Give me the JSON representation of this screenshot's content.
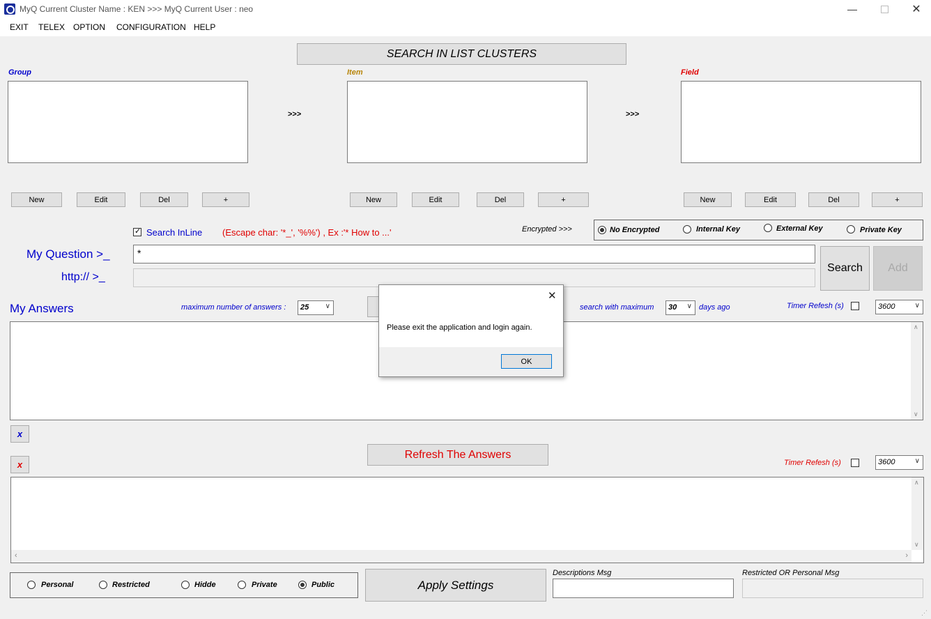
{
  "window": {
    "title": "MyQ Current Cluster Name : KEN >>> MyQ Current User : neo",
    "minimize_icon": "minimize-icon",
    "maximize_icon": "maximize-icon",
    "close_icon": "close-icon"
  },
  "menu": [
    "EXIT",
    "TELEX",
    "OPTION",
    "CONFIGURATION",
    "HELP"
  ],
  "search_clusters_label": "SEARCH IN LIST CLUSTERS",
  "columns": {
    "group": {
      "label": "Group",
      "color": "#0000cc"
    },
    "item": {
      "label": "Item",
      "color": "#b8860b"
    },
    "field": {
      "label": "Field",
      "color": "#e00000"
    },
    "arrow": ">>>"
  },
  "column_buttons": {
    "new": "New",
    "edit": "Edit",
    "del": "Del",
    "add": "+"
  },
  "search_inline": {
    "label": "Search InLine",
    "checked": true
  },
  "escape_hint": "(Escape char: '*_', '%%') , Ex :'* How to ...'",
  "encrypted_label": "Encrypted >>>",
  "encryption": {
    "selected": "No Encrypted",
    "options": [
      "No Encrypted",
      "Internal Key",
      "External Key",
      "Private Key"
    ]
  },
  "question": {
    "label": "My Question >_",
    "value": "*"
  },
  "http": {
    "label": "http:// >_",
    "value": ""
  },
  "search_button": "Search",
  "add_button": "Add",
  "answers": {
    "label": "My Answers",
    "max_label": "maximum number of answers :",
    "max_value": "25",
    "search_max_label": "search with maximum",
    "days_value": "30",
    "days_ago": "days ago",
    "timer_label": "Timer Refesh (s)",
    "timer_value": "3600"
  },
  "clear_buttons": {
    "blue": "x",
    "red": "x"
  },
  "refresh_button": "Refresh The Answers",
  "timer2": {
    "label": "Timer Refesh (s)",
    "value": "3600"
  },
  "visibility": {
    "selected": "Public",
    "options": [
      "Personal",
      "Restricted",
      "Hidde",
      "Private",
      "Public"
    ]
  },
  "apply_button": "Apply Settings",
  "descriptions_msg": {
    "label": "Descriptions Msg",
    "value": ""
  },
  "restricted_msg": {
    "label": "Restricted OR Personal Msg",
    "value": ""
  },
  "dialog": {
    "message": "Please exit the application and login again.",
    "ok": "OK",
    "close_icon": "close-icon"
  }
}
